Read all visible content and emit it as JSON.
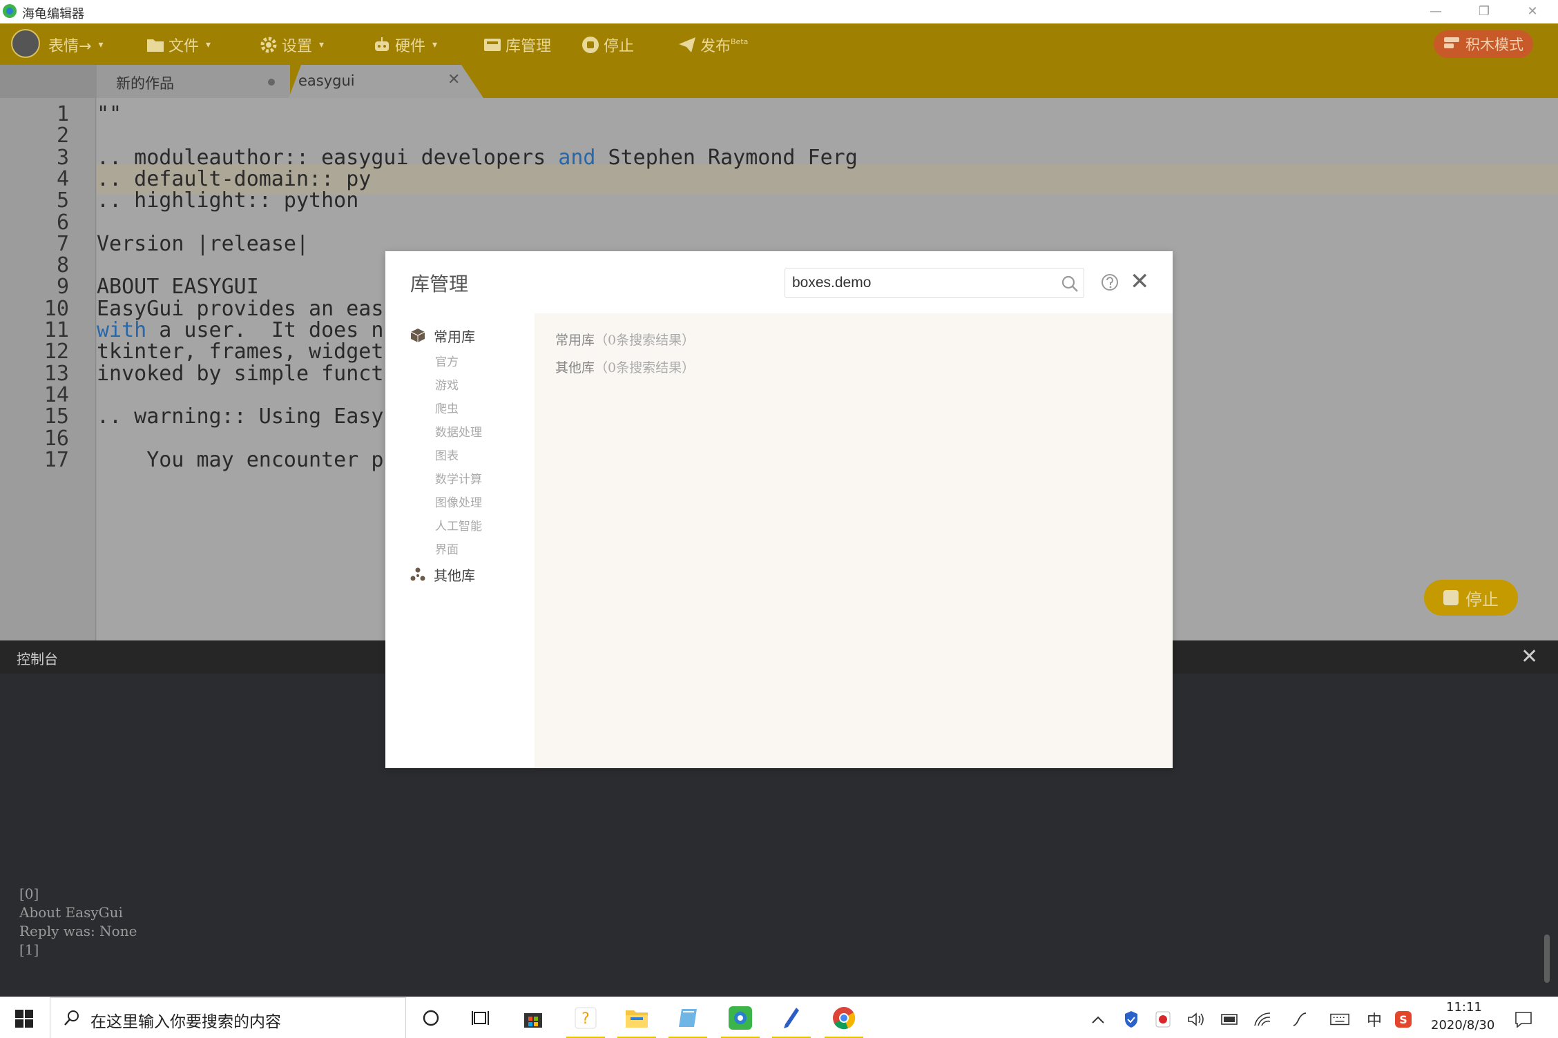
{
  "window": {
    "title": "海龟编辑器",
    "minimize": "—",
    "restore": "❐",
    "close": "✕"
  },
  "toolbar": {
    "avatar_label": "表情→",
    "file": "文件",
    "settings": "设置",
    "hardware": "硬件",
    "library": "库管理",
    "stop": "停止",
    "publish": "发布",
    "publish_badge": "Beta",
    "blocks_mode": "积木模式",
    "caret": "▾"
  },
  "tabs": [
    {
      "label": "新的作品"
    },
    {
      "label": "easygui",
      "close": "✕"
    }
  ],
  "editor": {
    "lines": [
      {
        "n": "1",
        "text": "\"\""
      },
      {
        "n": "2",
        "text": ""
      },
      {
        "n": "3",
        "pre": ".. moduleauthor:: easygui developers ",
        "kw": "and",
        "post": " Stephen Raymond Ferg"
      },
      {
        "n": "4",
        "text": ".. default-domain:: py"
      },
      {
        "n": "5",
        "text": ".. highlight:: python"
      },
      {
        "n": "6",
        "text": ""
      },
      {
        "n": "7",
        "text": "Version |release|"
      },
      {
        "n": "8",
        "text": ""
      },
      {
        "n": "9",
        "text": "ABOUT EASYGUI"
      },
      {
        "n": "10",
        "text": "EasyGui provides an eas"
      },
      {
        "n": "11",
        "pre": "",
        "kw": "with",
        "post": " a user.  It does n"
      },
      {
        "n": "12",
        "text": "tkinter, frames, widget"
      },
      {
        "n": "13",
        "text": "invoked by simple funct"
      },
      {
        "n": "14",
        "text": ""
      },
      {
        "n": "15",
        "text": ".. warning:: Using Easy"
      },
      {
        "n": "16",
        "text": ""
      },
      {
        "n": "17",
        "text": "    You may encounter p"
      }
    ],
    "stop_button": "停止"
  },
  "console": {
    "title": "控制台",
    "close": "✕",
    "output": "[0]\nAbout EasyGui\nReply was: None\n[1]"
  },
  "modal": {
    "title": "库管理",
    "search_value": "boxes.demo",
    "close": "✕",
    "categories": {
      "common": "常用库",
      "subs": [
        "官方",
        "游戏",
        "爬虫",
        "数据处理",
        "图表",
        "数学计算",
        "图像处理",
        "人工智能",
        "界面"
      ],
      "other": "其他库"
    },
    "results": [
      {
        "name": "常用库",
        "count": "（0条搜索结果）"
      },
      {
        "name": "其他库",
        "count": "（0条搜索结果）"
      }
    ]
  },
  "taskbar": {
    "search_placeholder": "在这里输入你要搜索的内容",
    "ime": "中",
    "time": "11:11",
    "date": "2020/8/30"
  },
  "colors": {
    "toolbar": "#a08000",
    "accent": "#c85a2a",
    "keyword": "#2868a8"
  }
}
